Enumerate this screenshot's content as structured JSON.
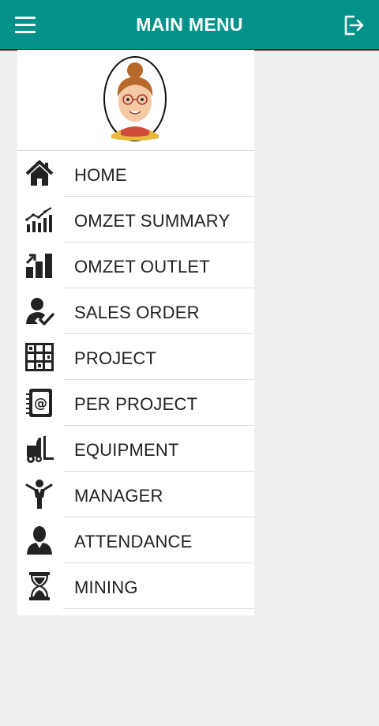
{
  "header": {
    "title": "MAIN MENU"
  },
  "menu": {
    "items": [
      {
        "label": "HOME",
        "icon": "home-icon"
      },
      {
        "label": "OMZET SUMMARY",
        "icon": "trend-chart-icon"
      },
      {
        "label": "OMZET OUTLET",
        "icon": "bar-chart-icon"
      },
      {
        "label": "SALES ORDER",
        "icon": "user-check-icon"
      },
      {
        "label": "PROJECT",
        "icon": "grid-board-icon"
      },
      {
        "label": "PER PROJECT",
        "icon": "address-book-icon"
      },
      {
        "label": "EQUIPMENT",
        "icon": "forklift-icon"
      },
      {
        "label": "MANAGER",
        "icon": "manager-icon"
      },
      {
        "label": "ATTENDANCE",
        "icon": "person-icon"
      },
      {
        "label": "MINING",
        "icon": "hourglass-icon"
      }
    ]
  },
  "colors": {
    "appbar": "#03918a",
    "drawer": "#ffffff",
    "background": "#efefef",
    "icon": "#222222"
  }
}
